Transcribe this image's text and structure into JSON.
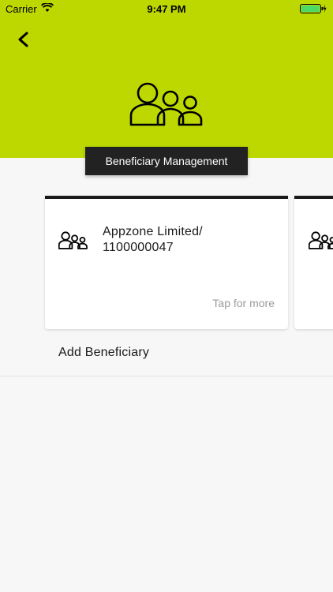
{
  "status_bar": {
    "carrier": "Carrier",
    "time": "9:47 PM"
  },
  "header": {
    "background_color": "#bcd800",
    "title": "Beneficiary Management"
  },
  "beneficiaries": [
    {
      "name": "Appzone Limited/\n1100000047",
      "hint": "Tap for more"
    },
    {
      "name": "",
      "hint": ""
    }
  ],
  "add_beneficiary_label": "Add Beneficiary",
  "icons": {
    "back": "chevron-left-icon",
    "hero": "people-group-icon",
    "card": "people-group-icon",
    "wifi": "wifi-icon",
    "battery": "battery-icon"
  }
}
